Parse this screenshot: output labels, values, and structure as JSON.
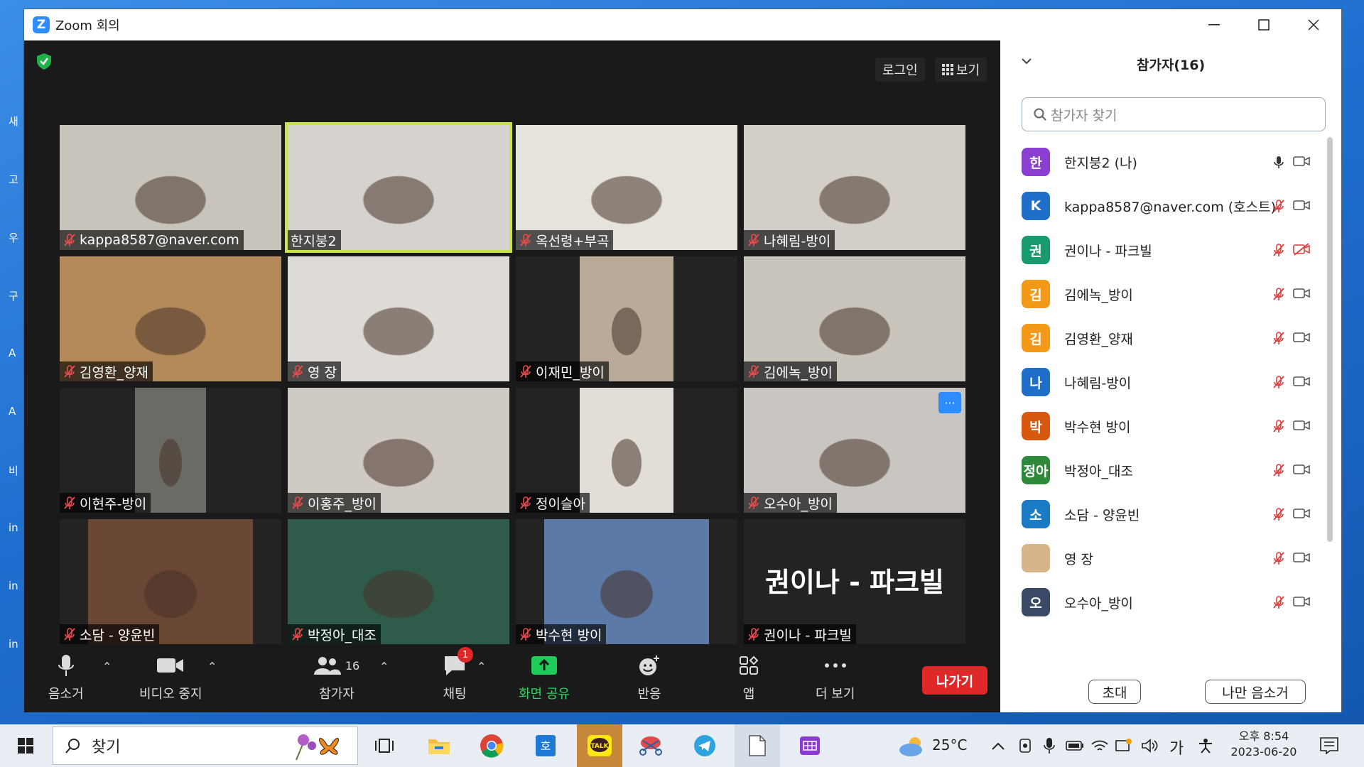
{
  "window": {
    "title": "Zoom 회의",
    "app_letter": "Z"
  },
  "meeting": {
    "login_label": "로그인",
    "view_label": "보기",
    "tiles": [
      {
        "name": "kappa8587@naver.com",
        "muted": true,
        "bg": "#c9c4bb",
        "vw": 312,
        "active": false
      },
      {
        "name": "한지붕2",
        "muted": false,
        "bg": "#d6d3cf",
        "vw": 312,
        "active": true
      },
      {
        "name": "옥선령+부곡",
        "muted": true,
        "bg": "#e6e2dc",
        "vw": 312,
        "active": false
      },
      {
        "name": "나혜림-방이",
        "muted": true,
        "bg": "#d3cfc8",
        "vw": 312,
        "active": false
      },
      {
        "name": "김영환_양재",
        "muted": true,
        "bg": "#b58a5a",
        "vw": 312,
        "active": false
      },
      {
        "name": "영 장",
        "muted": true,
        "bg": "#dedbd6",
        "vw": 312,
        "active": false
      },
      {
        "name": "이재민_방이",
        "muted": true,
        "bg": "#b9ab98",
        "vw": 132,
        "active": false
      },
      {
        "name": "김에녹_방이",
        "muted": true,
        "bg": "#c9c4bc",
        "vw": 312,
        "active": false
      },
      {
        "name": "이현주-방이",
        "muted": true,
        "bg": "#6b6b66",
        "vw": 100,
        "active": false
      },
      {
        "name": "이홍주_방이",
        "muted": true,
        "bg": "#cfcac3",
        "vw": 312,
        "active": false
      },
      {
        "name": "정이슬아",
        "muted": true,
        "bg": "#e2ddd6",
        "vw": 132,
        "active": false
      },
      {
        "name": "오수아_방이",
        "muted": true,
        "bg": "#c9c6c1",
        "vw": 312,
        "active": false,
        "more": true
      },
      {
        "name": "소담 - 양윤빈",
        "muted": true,
        "bg": "#6a4634",
        "vw": 232,
        "active": false
      },
      {
        "name": "박정아_대조",
        "muted": true,
        "bg": "#2f5c4a",
        "vw": 312,
        "active": false
      },
      {
        "name": "박수현 방이",
        "muted": true,
        "bg": "#5c7aa8",
        "vw": 232,
        "active": false
      },
      {
        "name": "권이나 - 파크빌",
        "muted": true,
        "bg": "#232323",
        "vw": 0,
        "active": false,
        "big_name": "권이나 - 파크빌"
      }
    ]
  },
  "toolbar": {
    "mute_label": "음소거",
    "video_label": "비디오 중지",
    "participants_label": "참가자",
    "participants_count": "16",
    "chat_label": "채팅",
    "chat_badge": "1",
    "share_label": "화면 공유",
    "reactions_label": "반응",
    "apps_label": "앱",
    "more_label": "더 보기",
    "leave_label": "나가기"
  },
  "panel": {
    "title": "참가자(16)",
    "search_placeholder": "참가자 찾기",
    "participants": [
      {
        "avatar": "한",
        "color": "#8a3fd1",
        "name": "한지붕2 (나)",
        "mic": "on",
        "cam": "on"
      },
      {
        "avatar": "K",
        "color": "#1f6fc9",
        "name": "kappa8587@naver.com (호스트)",
        "mic": "off",
        "cam": "on"
      },
      {
        "avatar": "권",
        "color": "#179a6c",
        "name": "권이나 - 파크빌",
        "mic": "off",
        "cam": "off"
      },
      {
        "avatar": "김",
        "color": "#f29a17",
        "name": "김에녹_방이",
        "mic": "off",
        "cam": "on"
      },
      {
        "avatar": "김",
        "color": "#f29a17",
        "name": "김영환_양재",
        "mic": "off",
        "cam": "on"
      },
      {
        "avatar": "나",
        "color": "#1f6fc9",
        "name": "나혜림-방이",
        "mic": "off",
        "cam": "on"
      },
      {
        "avatar": "박",
        "color": "#d9580f",
        "name": "박수현 방이",
        "mic": "off",
        "cam": "on"
      },
      {
        "avatar": "정아",
        "color": "#2e8a3a",
        "name": "박정아_대조",
        "mic": "off",
        "cam": "on"
      },
      {
        "avatar": "소",
        "color": "#1a7bc4",
        "name": "소담 - 양윤빈",
        "mic": "off",
        "cam": "on"
      },
      {
        "avatar": "",
        "color": "#d8b48a",
        "name": "영 장",
        "mic": "off",
        "cam": "on"
      },
      {
        "avatar": "오",
        "color": "#3a4a66",
        "name": "오수아_방이",
        "mic": "off",
        "cam": "on"
      },
      {
        "avatar": "",
        "color": "#8fa08a",
        "name": "옥선령+부곡",
        "mic": "off",
        "cam": "on"
      }
    ],
    "invite_label": "초대",
    "mute_me_label": "나만 음소거"
  },
  "desktop_icons": [
    "새",
    "고",
    "우",
    "구",
    "A",
    "A",
    "비",
    "in",
    "in",
    "in"
  ],
  "taskbar": {
    "search_label": "찾기",
    "weather_temp": "25°C",
    "ime_label": "가",
    "time": "오후 8:54",
    "date": "2023-06-20"
  }
}
